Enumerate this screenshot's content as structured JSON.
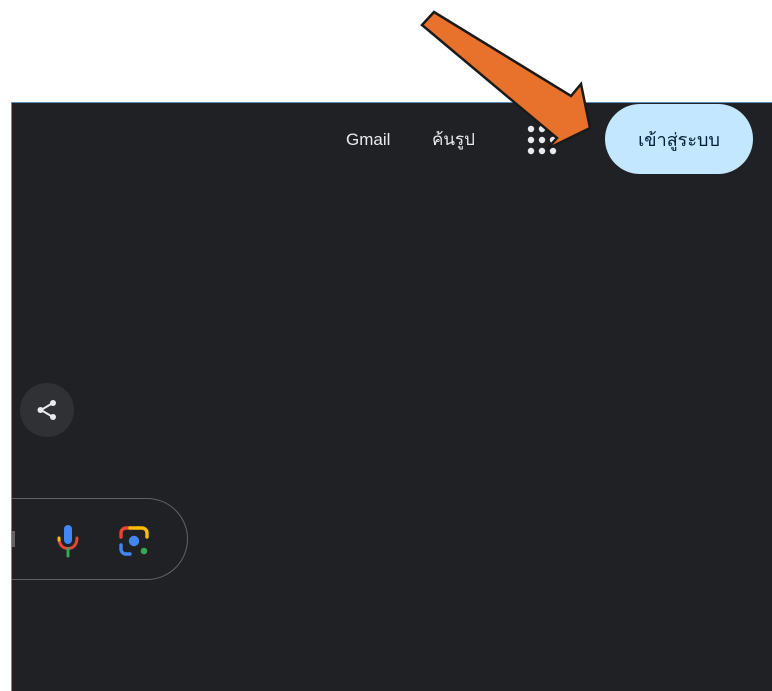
{
  "header": {
    "gmail_label": "Gmail",
    "images_label": "ค้นรูป",
    "apps_icon": "apps-grid-icon",
    "signin_label": "เข้าสู่ระบบ"
  },
  "share": {
    "icon": "share-icon"
  },
  "search": {
    "mic_icon": "microphone-icon",
    "lens_icon": "camera-lens-icon"
  },
  "annotation": {
    "arrow_color": "#e8722c"
  },
  "colors": {
    "background": "#202124",
    "signin_background": "#c2e7ff",
    "text": "#e8eaed"
  }
}
